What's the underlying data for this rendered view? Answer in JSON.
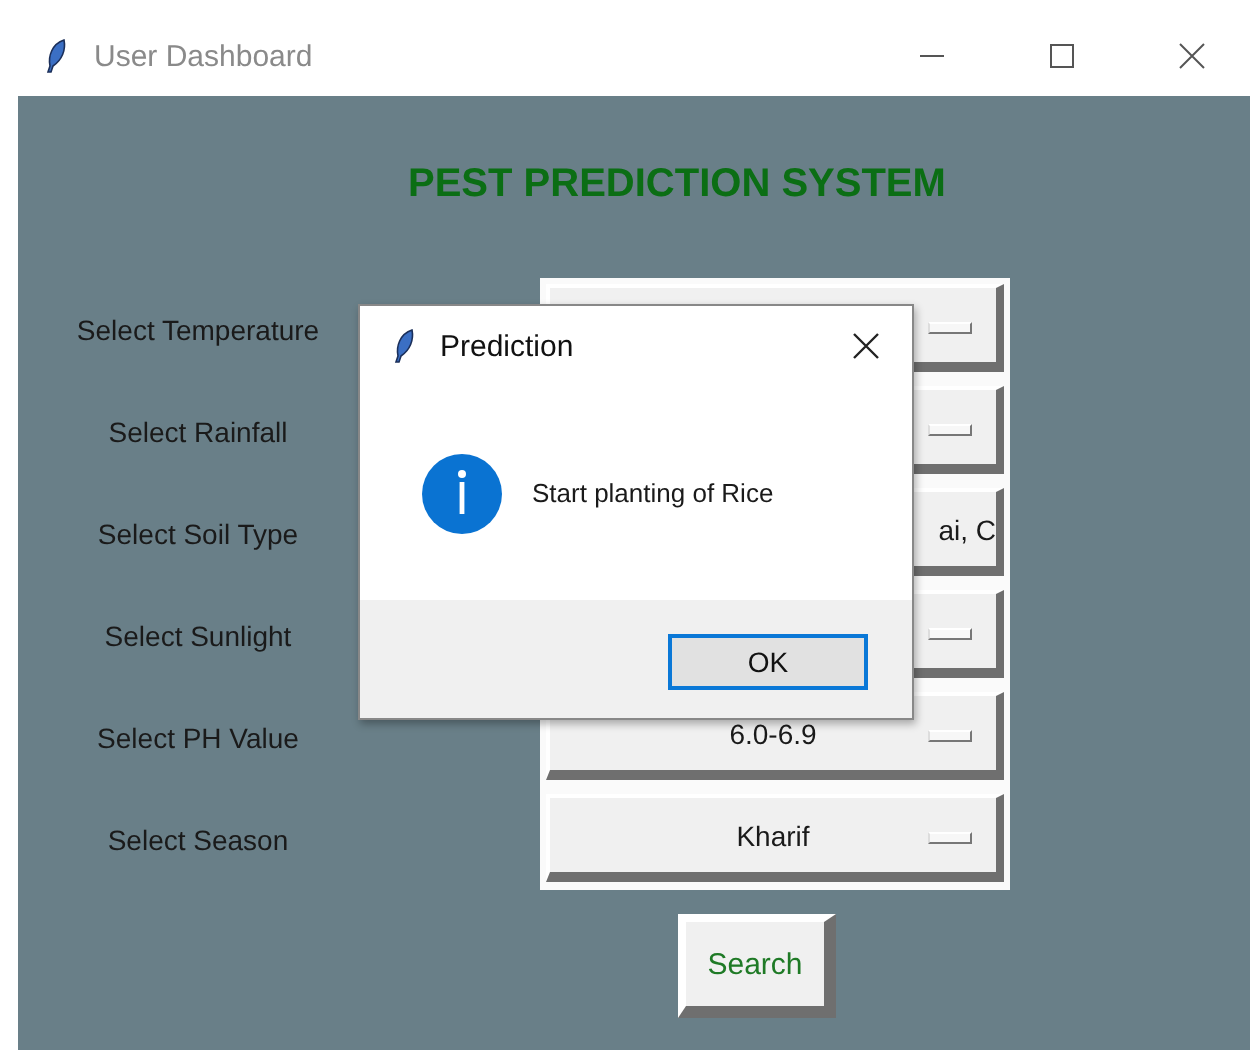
{
  "window": {
    "title": "User Dashboard"
  },
  "heading": "PEST PREDICTION SYSTEM",
  "fields": [
    {
      "label": "Select Temperature",
      "indicator": true
    },
    {
      "label": "Select Rainfall",
      "indicator": true
    },
    {
      "label": "Select Soil Type",
      "value": "ai, C",
      "indicator": false
    },
    {
      "label": "Select Sunlight",
      "indicator": true
    },
    {
      "label": "Select PH Value",
      "value": "6.0-6.9",
      "indicator": true
    },
    {
      "label": "Select Season",
      "value": "Kharif",
      "indicator": true
    }
  ],
  "search_button": "Search",
  "dialog": {
    "title": "Prediction",
    "message": "Start planting of Rice",
    "button": "OK"
  }
}
